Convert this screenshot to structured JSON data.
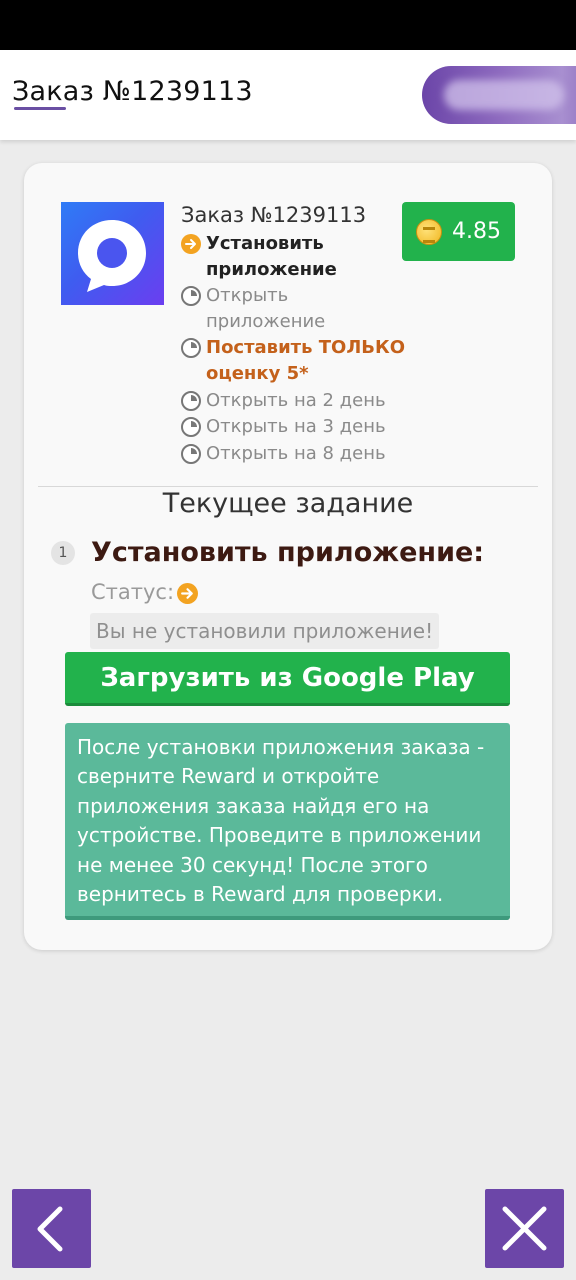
{
  "header": {
    "title": "Заказ №1239113"
  },
  "order": {
    "title": "Заказ №1239113",
    "reward": "4.85",
    "app_icon": "app-logo-icon",
    "steps": [
      {
        "label": "Установить приложение",
        "state": "active"
      },
      {
        "label": "Открыть приложение",
        "state": "pending"
      },
      {
        "label": "Поставить ТОЛЬКО оценку 5*",
        "state": "pending-warn"
      },
      {
        "label": "Открыть на 2 день",
        "state": "pending"
      },
      {
        "label": "Открыть на 3 день",
        "state": "pending"
      },
      {
        "label": "Открыть на 8 день",
        "state": "pending"
      }
    ]
  },
  "current_task": {
    "section_title": "Текущее задание",
    "number": "1",
    "title": "Установить приложение:",
    "status_label": "Статус:",
    "status_message": "Вы не установили приложение!",
    "download_button": "Загрузить из Google Play",
    "info": "После установки приложения заказа - сверните Reward и откройте приложения заказа найдя его на устройстве. Проведите в приложении не менее 30 секунд! После этого вернитесь в Reward для проверки."
  },
  "nav": {
    "back_icon": "chevron-left-icon",
    "close_icon": "close-icon"
  },
  "colors": {
    "accent": "#6c46a8",
    "success": "#22b24c",
    "info": "#5bb99a",
    "warning": "#f3a321",
    "warning_text": "#c4611b"
  }
}
